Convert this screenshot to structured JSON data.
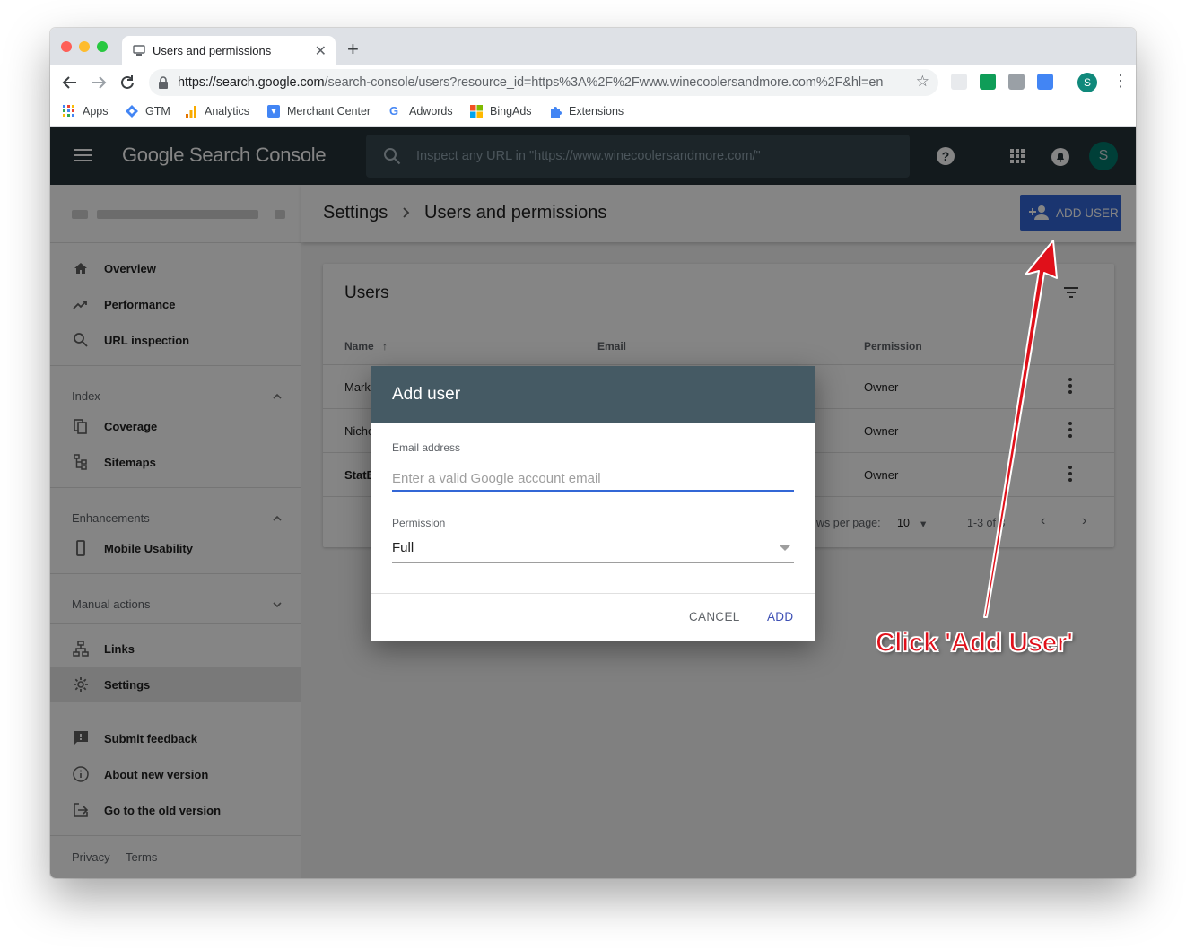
{
  "browser": {
    "tab_title": "Users and permissions",
    "url_host": "https://search.google.com",
    "url_path": "/search-console/users?resource_id=https%3A%2F%2Fwww.winecoolersandmore.com%2F&hl=en",
    "profile_initial": "S",
    "bookmarks": [
      {
        "label": "Apps",
        "icon": "apps-grid-icon"
      },
      {
        "label": "GTM",
        "icon": "gtm-icon"
      },
      {
        "label": "Analytics",
        "icon": "analytics-icon"
      },
      {
        "label": "Merchant Center",
        "icon": "merchant-center-icon"
      },
      {
        "label": "Adwords",
        "icon": "google-g-icon"
      },
      {
        "label": "BingAds",
        "icon": "bingads-icon"
      },
      {
        "label": "Extensions",
        "icon": "puzzle-icon"
      }
    ]
  },
  "appbar": {
    "logo": "Google Search Console",
    "search_placeholder": "Inspect any URL in \"https://www.winecoolersandmore.com/\"",
    "avatar_initial": "S"
  },
  "sidebar": {
    "items_top": [
      {
        "label": "Overview",
        "icon": "home-icon"
      },
      {
        "label": "Performance",
        "icon": "trending-up-icon"
      },
      {
        "label": "URL inspection",
        "icon": "search-icon"
      }
    ],
    "index_header": "Index",
    "index_items": [
      {
        "label": "Coverage",
        "icon": "copy-icon"
      },
      {
        "label": "Sitemaps",
        "icon": "sitemap-icon"
      }
    ],
    "enhancements_header": "Enhancements",
    "enhancement_items": [
      {
        "label": "Mobile Usability",
        "icon": "smartphone-icon"
      }
    ],
    "manual_actions_header": "Manual actions",
    "other_items": [
      {
        "label": "Links",
        "icon": "links-icon"
      },
      {
        "label": "Settings",
        "icon": "gear-icon"
      }
    ],
    "footer_items": [
      {
        "label": "Submit feedback",
        "icon": "feedback-icon"
      },
      {
        "label": "About new version",
        "icon": "info-icon"
      },
      {
        "label": "Go to the old version",
        "icon": "exit-icon"
      }
    ],
    "privacy": "Privacy",
    "terms": "Terms"
  },
  "header": {
    "crumb_parent": "Settings",
    "crumb_current": "Users and permissions",
    "add_user_label": "ADD USER"
  },
  "users_card": {
    "title": "Users",
    "columns": {
      "name": "Name",
      "email": "Email",
      "permission": "Permission"
    },
    "rows": [
      {
        "name": "Mark",
        "permission": "Owner"
      },
      {
        "name": "Nicho",
        "permission": "Owner"
      },
      {
        "name": "StatB",
        "permission": "Owner"
      }
    ],
    "rows_per_page_label": "ws per page:",
    "rows_per_page": "10",
    "range": "1-3 of 3"
  },
  "dialog": {
    "title": "Add user",
    "email_label": "Email address",
    "email_placeholder": "Enter a valid Google account email",
    "permission_label": "Permission",
    "permission_value": "Full",
    "cancel": "CANCEL",
    "add": "ADD"
  },
  "annotation": {
    "text": "Click 'Add User'",
    "color": "#e0101a"
  },
  "colors": {
    "appbar": "#263238",
    "dialog_header": "#455a64",
    "primary_button": "#3367d6"
  }
}
